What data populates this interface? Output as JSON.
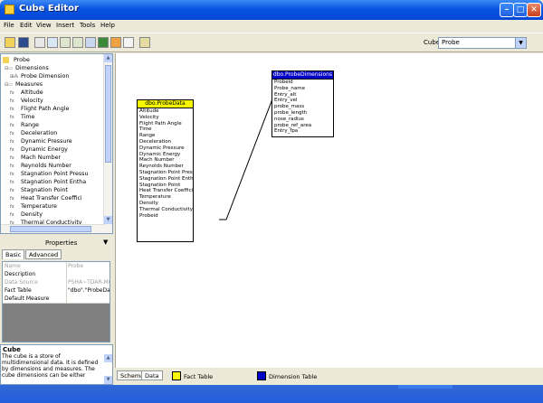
{
  "window": {
    "title": "Cube Editor"
  },
  "menu": [
    "File",
    "Edit",
    "View",
    "Insert",
    "Tools",
    "Help"
  ],
  "toolbar": {
    "cube_label": "Cube:",
    "cube_value": "Probe"
  },
  "tree": {
    "root": "Probe",
    "dimensions_label": "Dimensions",
    "dimension_item": "Probe Dimension",
    "measures_label": "Measures",
    "measures": [
      "Altitude",
      "Velocity",
      "Flight Path Angle",
      "Time",
      "Range",
      "Deceleration",
      "Dynamic Pressure",
      "Dynamic   Energy",
      "Mach     Number",
      "Reynolds Number",
      "Stagnation Point Pressu",
      "Stagnation Point Entha",
      "Stagnation Point",
      "Heat Transfer Coeffici",
      "Temperature",
      "Density",
      "Thermal Conductivity"
    ]
  },
  "properties": {
    "title": "Properties",
    "tabs": [
      "Basic",
      "Advanced"
    ],
    "rows": [
      {
        "name": "Name",
        "value": "Probe",
        "greyed": true
      },
      {
        "name": "Description",
        "value": "",
        "greyed": false
      },
      {
        "name": "Data Source",
        "value": "PSHA~TDAR-MOBL",
        "greyed": true
      },
      {
        "name": "Fact Table",
        "value": "\"dbo\".\"ProbeData",
        "greyed": false
      },
      {
        "name": "Default Measure",
        "value": "",
        "greyed": false
      }
    ]
  },
  "description": {
    "title": "Cube",
    "text": "The cube is a store of multidimensional data. It is defined by dimensions and measures. The cube dimensions can be either"
  },
  "fact_table": {
    "name": "dbo.ProbeData",
    "fields": [
      "Altitude",
      "Velocity",
      "Flight Path Angle",
      "Time",
      "Range",
      "Deceleration",
      "Dynamic Pressure",
      "Dynamic   Energy",
      "Mach     Number",
      "Reynolds Number",
      "Stagnation Point Press",
      "Stagnation Point Enth.",
      "Stagnation Point",
      "Heat Transfer Coeffici",
      "Temperature",
      "Density",
      "Thermal Conductivity",
      "Probeid"
    ]
  },
  "dim_table": {
    "name": "dbo.ProbeDimensions",
    "fields": [
      "Probeid",
      "Probe_name",
      "Entry_alt",
      "Entry_vel",
      "probe_mass",
      "probe_length",
      "nose_radius",
      "probe_ref_area",
      "Entry_fpa"
    ]
  },
  "status": {
    "tabs": [
      "Schema",
      "Data"
    ],
    "legend": [
      {
        "label": "Fact Table",
        "color": "#f7f701"
      },
      {
        "label": "Dimension Table",
        "color": "#0000c8"
      }
    ]
  }
}
